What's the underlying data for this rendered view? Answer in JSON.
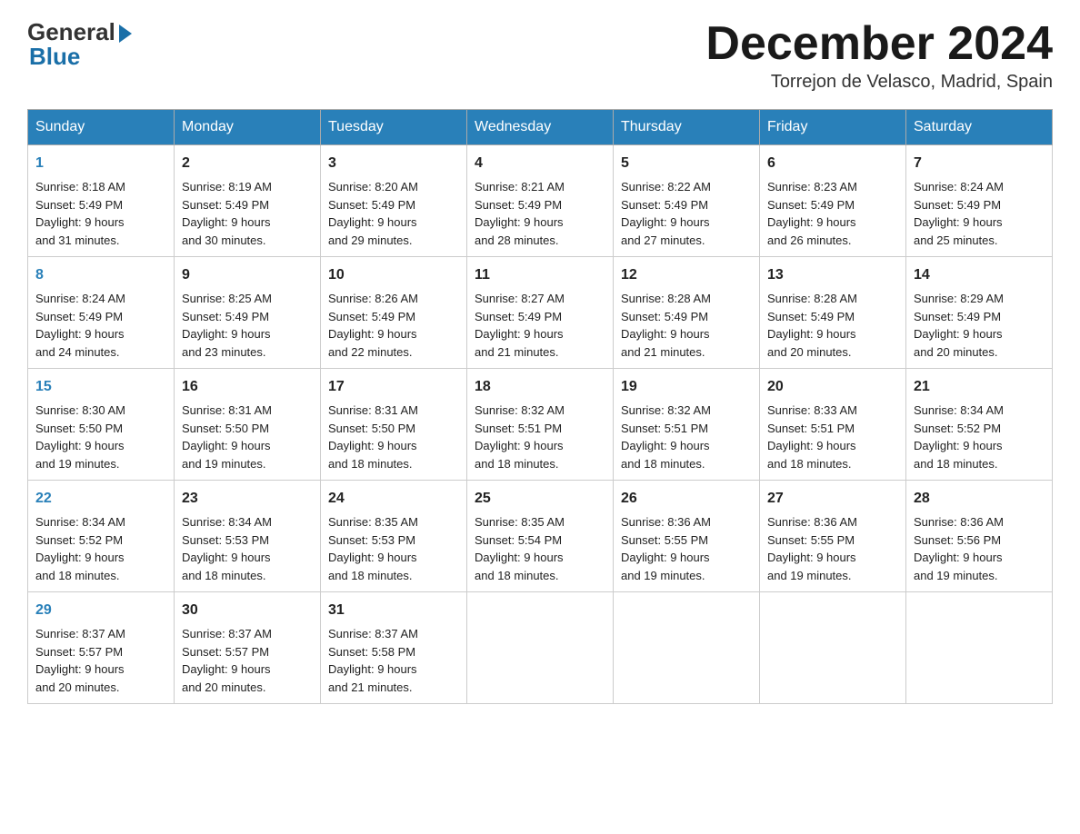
{
  "logo": {
    "general": "General",
    "blue": "Blue"
  },
  "header": {
    "month": "December 2024",
    "location": "Torrejon de Velasco, Madrid, Spain"
  },
  "weekdays": [
    "Sunday",
    "Monday",
    "Tuesday",
    "Wednesday",
    "Thursday",
    "Friday",
    "Saturday"
  ],
  "weeks": [
    [
      {
        "day": "1",
        "sunrise": "8:18 AM",
        "sunset": "5:49 PM",
        "daylight": "9 hours and 31 minutes."
      },
      {
        "day": "2",
        "sunrise": "8:19 AM",
        "sunset": "5:49 PM",
        "daylight": "9 hours and 30 minutes."
      },
      {
        "day": "3",
        "sunrise": "8:20 AM",
        "sunset": "5:49 PM",
        "daylight": "9 hours and 29 minutes."
      },
      {
        "day": "4",
        "sunrise": "8:21 AM",
        "sunset": "5:49 PM",
        "daylight": "9 hours and 28 minutes."
      },
      {
        "day": "5",
        "sunrise": "8:22 AM",
        "sunset": "5:49 PM",
        "daylight": "9 hours and 27 minutes."
      },
      {
        "day": "6",
        "sunrise": "8:23 AM",
        "sunset": "5:49 PM",
        "daylight": "9 hours and 26 minutes."
      },
      {
        "day": "7",
        "sunrise": "8:24 AM",
        "sunset": "5:49 PM",
        "daylight": "9 hours and 25 minutes."
      }
    ],
    [
      {
        "day": "8",
        "sunrise": "8:24 AM",
        "sunset": "5:49 PM",
        "daylight": "9 hours and 24 minutes."
      },
      {
        "day": "9",
        "sunrise": "8:25 AM",
        "sunset": "5:49 PM",
        "daylight": "9 hours and 23 minutes."
      },
      {
        "day": "10",
        "sunrise": "8:26 AM",
        "sunset": "5:49 PM",
        "daylight": "9 hours and 22 minutes."
      },
      {
        "day": "11",
        "sunrise": "8:27 AM",
        "sunset": "5:49 PM",
        "daylight": "9 hours and 21 minutes."
      },
      {
        "day": "12",
        "sunrise": "8:28 AM",
        "sunset": "5:49 PM",
        "daylight": "9 hours and 21 minutes."
      },
      {
        "day": "13",
        "sunrise": "8:28 AM",
        "sunset": "5:49 PM",
        "daylight": "9 hours and 20 minutes."
      },
      {
        "day": "14",
        "sunrise": "8:29 AM",
        "sunset": "5:49 PM",
        "daylight": "9 hours and 20 minutes."
      }
    ],
    [
      {
        "day": "15",
        "sunrise": "8:30 AM",
        "sunset": "5:50 PM",
        "daylight": "9 hours and 19 minutes."
      },
      {
        "day": "16",
        "sunrise": "8:31 AM",
        "sunset": "5:50 PM",
        "daylight": "9 hours and 19 minutes."
      },
      {
        "day": "17",
        "sunrise": "8:31 AM",
        "sunset": "5:50 PM",
        "daylight": "9 hours and 18 minutes."
      },
      {
        "day": "18",
        "sunrise": "8:32 AM",
        "sunset": "5:51 PM",
        "daylight": "9 hours and 18 minutes."
      },
      {
        "day": "19",
        "sunrise": "8:32 AM",
        "sunset": "5:51 PM",
        "daylight": "9 hours and 18 minutes."
      },
      {
        "day": "20",
        "sunrise": "8:33 AM",
        "sunset": "5:51 PM",
        "daylight": "9 hours and 18 minutes."
      },
      {
        "day": "21",
        "sunrise": "8:34 AM",
        "sunset": "5:52 PM",
        "daylight": "9 hours and 18 minutes."
      }
    ],
    [
      {
        "day": "22",
        "sunrise": "8:34 AM",
        "sunset": "5:52 PM",
        "daylight": "9 hours and 18 minutes."
      },
      {
        "day": "23",
        "sunrise": "8:34 AM",
        "sunset": "5:53 PM",
        "daylight": "9 hours and 18 minutes."
      },
      {
        "day": "24",
        "sunrise": "8:35 AM",
        "sunset": "5:53 PM",
        "daylight": "9 hours and 18 minutes."
      },
      {
        "day": "25",
        "sunrise": "8:35 AM",
        "sunset": "5:54 PM",
        "daylight": "9 hours and 18 minutes."
      },
      {
        "day": "26",
        "sunrise": "8:36 AM",
        "sunset": "5:55 PM",
        "daylight": "9 hours and 19 minutes."
      },
      {
        "day": "27",
        "sunrise": "8:36 AM",
        "sunset": "5:55 PM",
        "daylight": "9 hours and 19 minutes."
      },
      {
        "day": "28",
        "sunrise": "8:36 AM",
        "sunset": "5:56 PM",
        "daylight": "9 hours and 19 minutes."
      }
    ],
    [
      {
        "day": "29",
        "sunrise": "8:37 AM",
        "sunset": "5:57 PM",
        "daylight": "9 hours and 20 minutes."
      },
      {
        "day": "30",
        "sunrise": "8:37 AM",
        "sunset": "5:57 PM",
        "daylight": "9 hours and 20 minutes."
      },
      {
        "day": "31",
        "sunrise": "8:37 AM",
        "sunset": "5:58 PM",
        "daylight": "9 hours and 21 minutes."
      },
      null,
      null,
      null,
      null
    ]
  ],
  "labels": {
    "sunrise": "Sunrise:",
    "sunset": "Sunset:",
    "daylight": "Daylight:"
  }
}
